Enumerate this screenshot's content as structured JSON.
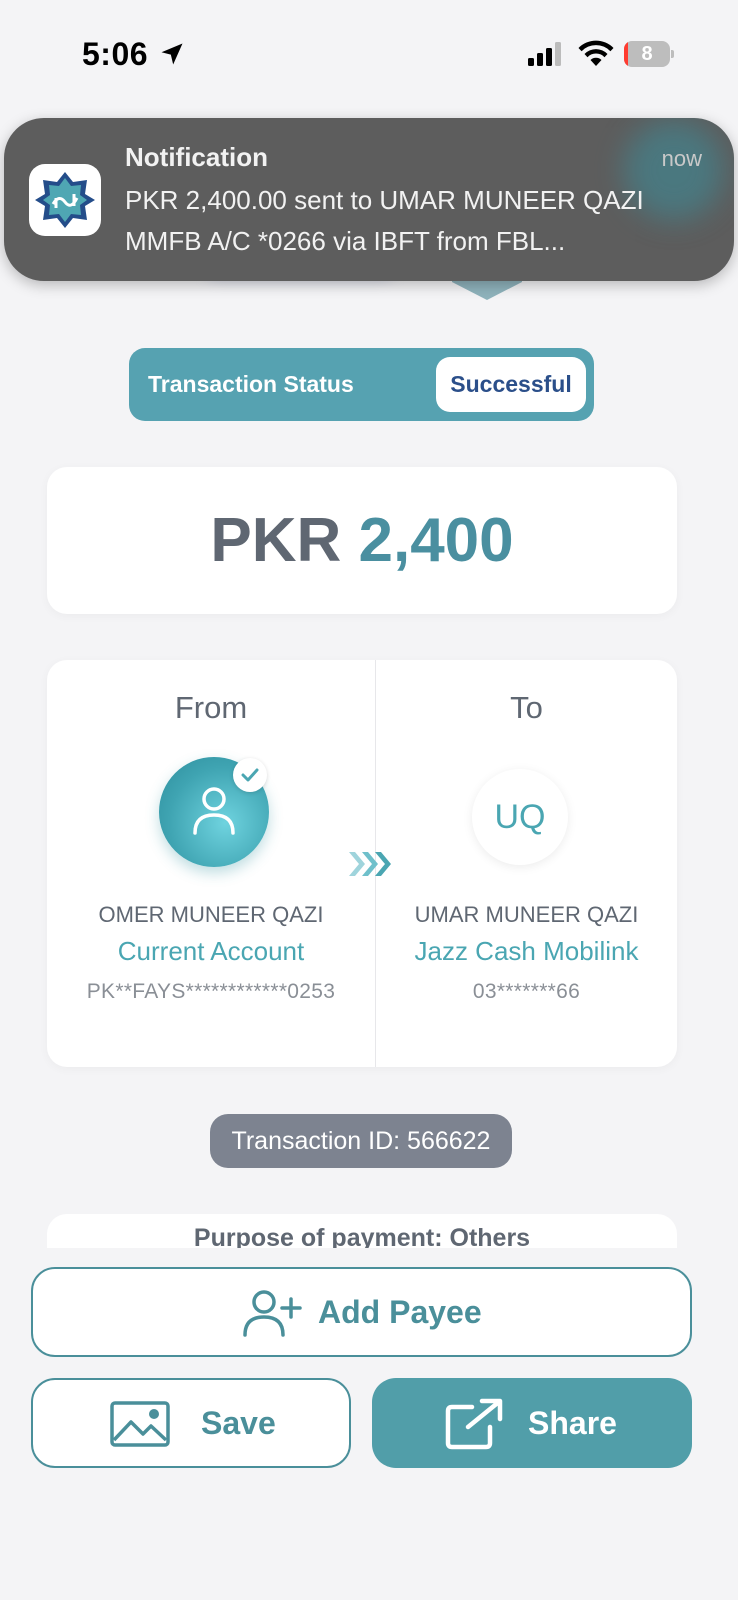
{
  "status_bar": {
    "time": "5:06",
    "battery_level": "8",
    "battery_percent": 8
  },
  "notification": {
    "title": "Notification",
    "time": "now",
    "body": "PKR 2,400.00 sent to UMAR MUNEER QAZI MMFB A/C *0266 via IBFT from FBL...",
    "app_icon": "faysal-bank-logo-icon"
  },
  "transaction_status": {
    "label": "Transaction Status",
    "value": "Successful"
  },
  "amount": {
    "currency": "PKR",
    "value": "2,400"
  },
  "from": {
    "heading": "From",
    "name": "OMER MUNEER QAZI",
    "account_type": "Current Account",
    "account_number": "PK**FAYS************0253",
    "avatar_icon": "person-icon",
    "verified": true
  },
  "to": {
    "heading": "To",
    "initials": "UQ",
    "name": "UMAR MUNEER QAZI",
    "account_type": "Jazz Cash Mobilink",
    "account_number": "03*******66"
  },
  "transaction_id": "Transaction ID: 566622",
  "purpose": "Purpose of payment: Others",
  "buttons": {
    "add_payee": "Add Payee",
    "save": "Save",
    "share": "Share"
  },
  "colors": {
    "accent": "#519ea9",
    "accent_text": "#4aa6b2",
    "status_blue": "#2b4f8a",
    "chip_gray": "#7d8390"
  }
}
